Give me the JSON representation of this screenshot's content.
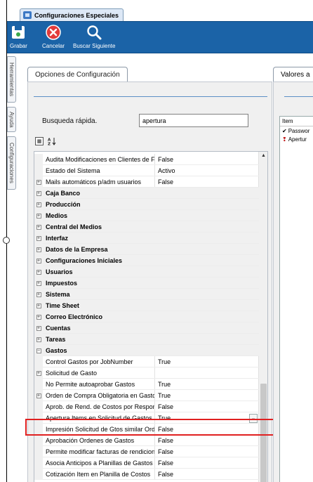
{
  "window": {
    "tab_title": "Configuraciones Especiales"
  },
  "toolbar": {
    "save_label": "Grabar",
    "cancel_label": "Cancelar",
    "find_next_label": "Buscar Siguiente",
    "save_icon": "floppy-disk-icon",
    "cancel_icon": "cancel-circle-icon",
    "find_icon": "magnifier-icon"
  },
  "side_tabs": [
    "Herramientas",
    "Ayuda",
    "Configuraciones"
  ],
  "options_panel": {
    "title": "Opciones de Configuración",
    "quick_search_label": "Busqueda rápida.",
    "quick_search_value": "apertura",
    "rows": [
      {
        "type": "prop",
        "name": "Audita Modificaciones en Clientes de Fa",
        "value": "False"
      },
      {
        "type": "prop",
        "name": "Estado del Sistema",
        "value": "Activo"
      },
      {
        "type": "prop",
        "name": "Mails automáticos p/adm usuarios",
        "value": "False",
        "expander": "+"
      },
      {
        "type": "cat",
        "name": "Caja Banco",
        "expander": "+"
      },
      {
        "type": "cat",
        "name": "Producción",
        "expander": "+"
      },
      {
        "type": "cat",
        "name": "Medios",
        "expander": "+"
      },
      {
        "type": "cat",
        "name": "Central del Medios",
        "expander": "+"
      },
      {
        "type": "cat",
        "name": "Interfaz",
        "expander": "+"
      },
      {
        "type": "cat",
        "name": "Datos de la Empresa",
        "expander": "+"
      },
      {
        "type": "cat",
        "name": "Configuraciones Iniciales",
        "expander": "+"
      },
      {
        "type": "cat",
        "name": "Usuarios",
        "expander": "+"
      },
      {
        "type": "cat",
        "name": "Impuestos",
        "expander": "+"
      },
      {
        "type": "cat",
        "name": "Sistema",
        "expander": "+"
      },
      {
        "type": "cat",
        "name": "Time Sheet",
        "expander": "+"
      },
      {
        "type": "cat",
        "name": "Correo Electrónico",
        "expander": "+"
      },
      {
        "type": "cat",
        "name": "Cuentas",
        "expander": "+"
      },
      {
        "type": "cat",
        "name": "Tareas",
        "expander": "+"
      },
      {
        "type": "cat",
        "name": "Gastos",
        "expander": "−"
      },
      {
        "type": "prop",
        "name": "Control Gastos por JobNumber",
        "value": "True"
      },
      {
        "type": "prop",
        "name": "Solicitud de Gasto",
        "value": "",
        "expander": "+"
      },
      {
        "type": "prop",
        "name": "No Permite autoaprobar Gastos",
        "value": "True"
      },
      {
        "type": "prop",
        "name": "Orden de Compra Obligatoria en Gastos",
        "value": "True",
        "expander": "+"
      },
      {
        "type": "prop",
        "name": "Aprob. de Rend. de Costos por Responsa",
        "value": "False"
      },
      {
        "type": "prop",
        "name": "Apertura Items en Solicitud de Gastos",
        "value": "True",
        "selected": true
      },
      {
        "type": "prop",
        "name": "Impresión Solicitud de Gtos similar Ord.",
        "value": "False"
      },
      {
        "type": "prop",
        "name": "Aprobación Ordenes de Gastos",
        "value": "False"
      },
      {
        "type": "prop",
        "name": "Permite modificar facturas de rendicion",
        "value": "False"
      },
      {
        "type": "prop",
        "name": "Asocia Anticipos a Planillas de Gastos",
        "value": "False"
      },
      {
        "type": "prop",
        "name": "Cotización Item en Planilla de Costos",
        "value": "False"
      }
    ]
  },
  "values_panel": {
    "title": "Valores a",
    "list_header": "Item",
    "items": [
      {
        "label": "Passwor",
        "icon": "checkmark-icon"
      },
      {
        "label": "Apertur",
        "icon": "exclamation-icon"
      }
    ]
  },
  "colors": {
    "toolbar": "#1b63a7",
    "highlight": "#e02020",
    "accent_line": "#5b8fc6"
  }
}
